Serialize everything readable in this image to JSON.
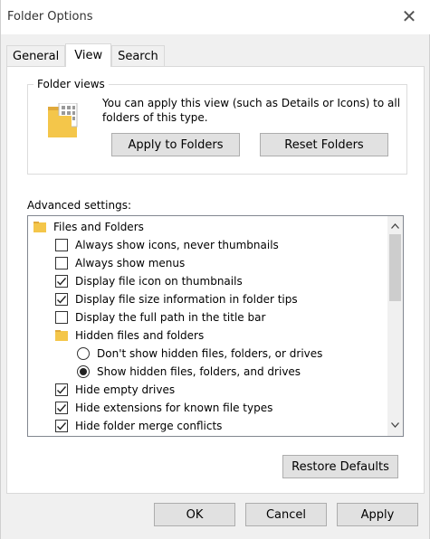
{
  "window": {
    "title": "Folder Options",
    "close_glyph": "✕"
  },
  "tabs": [
    {
      "label": "General",
      "active": false
    },
    {
      "label": "View",
      "active": true
    },
    {
      "label": "Search",
      "active": false
    }
  ],
  "folder_views": {
    "label": "Folder views",
    "description": "You can apply this view (such as Details or Icons) to all folders of this type.",
    "apply_label": "Apply to Folders",
    "reset_label": "Reset Folders"
  },
  "advanced": {
    "label": "Advanced settings:",
    "items": [
      {
        "type": "folder",
        "label": "Files and Folders"
      },
      {
        "type": "checkbox",
        "label": "Always show icons, never thumbnails",
        "checked": false
      },
      {
        "type": "checkbox",
        "label": "Always show menus",
        "checked": false
      },
      {
        "type": "checkbox",
        "label": "Display file icon on thumbnails",
        "checked": true
      },
      {
        "type": "checkbox",
        "label": "Display file size information in folder tips",
        "checked": true
      },
      {
        "type": "checkbox",
        "label": "Display the full path in the title bar",
        "checked": false
      },
      {
        "type": "folder",
        "label": "Hidden files and folders"
      },
      {
        "type": "radio",
        "label": "Don't show hidden files, folders, or drives",
        "checked": false
      },
      {
        "type": "radio",
        "label": "Show hidden files, folders, and drives",
        "checked": true
      },
      {
        "type": "checkbox",
        "label": "Hide empty drives",
        "checked": true
      },
      {
        "type": "checkbox",
        "label": "Hide extensions for known file types",
        "checked": true
      },
      {
        "type": "checkbox",
        "label": "Hide folder merge conflicts",
        "checked": true
      }
    ]
  },
  "restore_label": "Restore Defaults",
  "footer": {
    "ok": "OK",
    "cancel": "Cancel",
    "apply": "Apply"
  },
  "colors": {
    "folder": "#f4c64a",
    "button_bg": "#e1e1e1",
    "button_border": "#adadad"
  }
}
